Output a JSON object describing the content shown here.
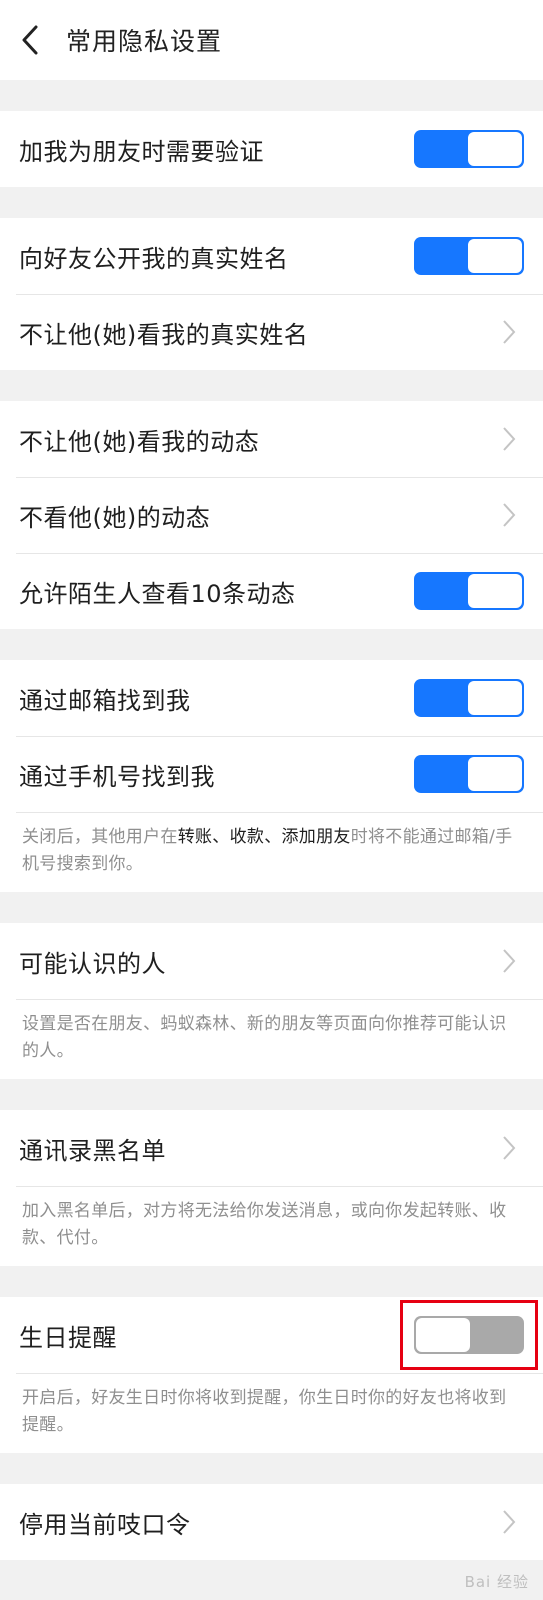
{
  "header": {
    "title": "常用隐私设置"
  },
  "groups": [
    {
      "rows": [
        {
          "label": "加我为朋友时需要验证",
          "control": "toggle",
          "state": "on"
        }
      ]
    },
    {
      "rows": [
        {
          "label": "向好友公开我的真实姓名",
          "control": "toggle",
          "state": "on"
        },
        {
          "label": "不让他(她)看我的真实姓名",
          "control": "chevron"
        }
      ]
    },
    {
      "rows": [
        {
          "label": "不让他(她)看我的动态",
          "control": "chevron"
        },
        {
          "label": "不看他(她)的动态",
          "control": "chevron"
        },
        {
          "label": "允许陌生人查看10条动态",
          "control": "toggle",
          "state": "on"
        }
      ]
    },
    {
      "rows": [
        {
          "label": "通过邮箱找到我",
          "control": "toggle",
          "state": "on"
        },
        {
          "label": "通过手机号找到我",
          "control": "toggle",
          "state": "on"
        }
      ],
      "note": {
        "p1": "关闭后，其他用户在",
        "b1": "转账、收款、添加朋友",
        "p2": "时将不能通过邮箱/手机号搜索到你。"
      }
    },
    {
      "rows": [
        {
          "label": "可能认识的人",
          "control": "chevron"
        }
      ],
      "note": {
        "p1": "设置是否在朋友、蚂蚁森林、新的朋友等页面向你推荐可能认识的人。"
      }
    },
    {
      "rows": [
        {
          "label": "通讯录黑名单",
          "control": "chevron"
        }
      ],
      "note": {
        "p1": "加入黑名单后，对方将无法给你发送消息，或向你发起转账、收款、代付。"
      }
    },
    {
      "rows": [
        {
          "label": "生日提醒",
          "control": "toggle",
          "state": "off",
          "highlighted": true
        }
      ],
      "note": {
        "p1": "开启后，好友生日时你将收到提醒，你生日时你的好友也将收到提醒。"
      }
    },
    {
      "rows": [
        {
          "label": "停用当前吱口令",
          "control": "chevron"
        }
      ]
    }
  ],
  "watermark": "Bai 经验",
  "colors": {
    "toggle_on": "#1677ff",
    "toggle_off": "#a9a9a9",
    "highlight": "#e60012"
  }
}
